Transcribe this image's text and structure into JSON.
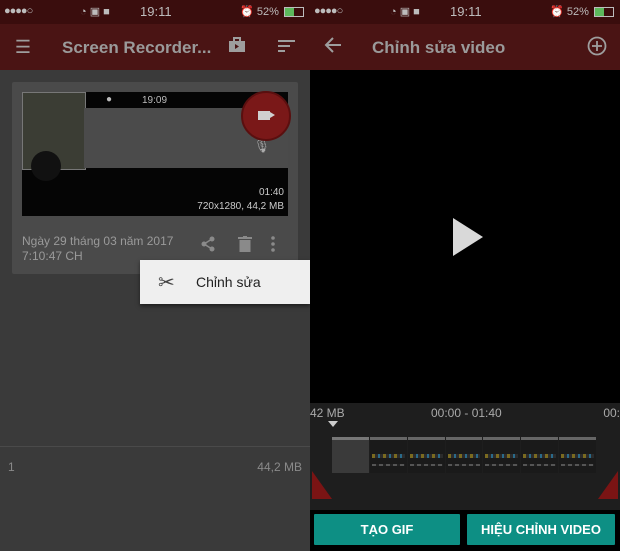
{
  "status_left": {
    "signal": "●●●●○",
    "time": "19:11",
    "battery": "52%",
    "battery_level": 0.52
  },
  "status_right": {
    "signal": "●●●●○",
    "time": "19:11",
    "battery": "52%",
    "battery_level": 0.52
  },
  "left_toolbar": {
    "title": "Screen Recorder...",
    "menu_icon": "hamburger-icon",
    "icons": [
      "briefcase-icon",
      "sort-icon"
    ]
  },
  "recording": {
    "thumb_time": "19:09",
    "duration": "01:40",
    "resolution_size": "720x1280, 44,2 MB",
    "date_line1": "Ngày 29 tháng 03 năm 2017",
    "date_line2": "7:10:47 CH"
  },
  "popup_menu": {
    "edit_label": "Chỉnh sửa"
  },
  "left_footer": {
    "count": "1",
    "total_size": "44,2 MB"
  },
  "right_toolbar": {
    "title": "Chỉnh sửa video",
    "back_icon": "back-arrow-icon",
    "add_icon": "add-circle-icon"
  },
  "timeline": {
    "size_label": "42 MB",
    "range_label": "00:00 - 01:40",
    "right_label": "00:"
  },
  "actions": {
    "gif_label": "TẠO GIF",
    "edit_video_label": "HIỆU CHỈNH VIDEO"
  },
  "colors": {
    "toolbar": "#4a1414",
    "accent_button": "#0d8f84",
    "record_button": "#7a1818"
  }
}
